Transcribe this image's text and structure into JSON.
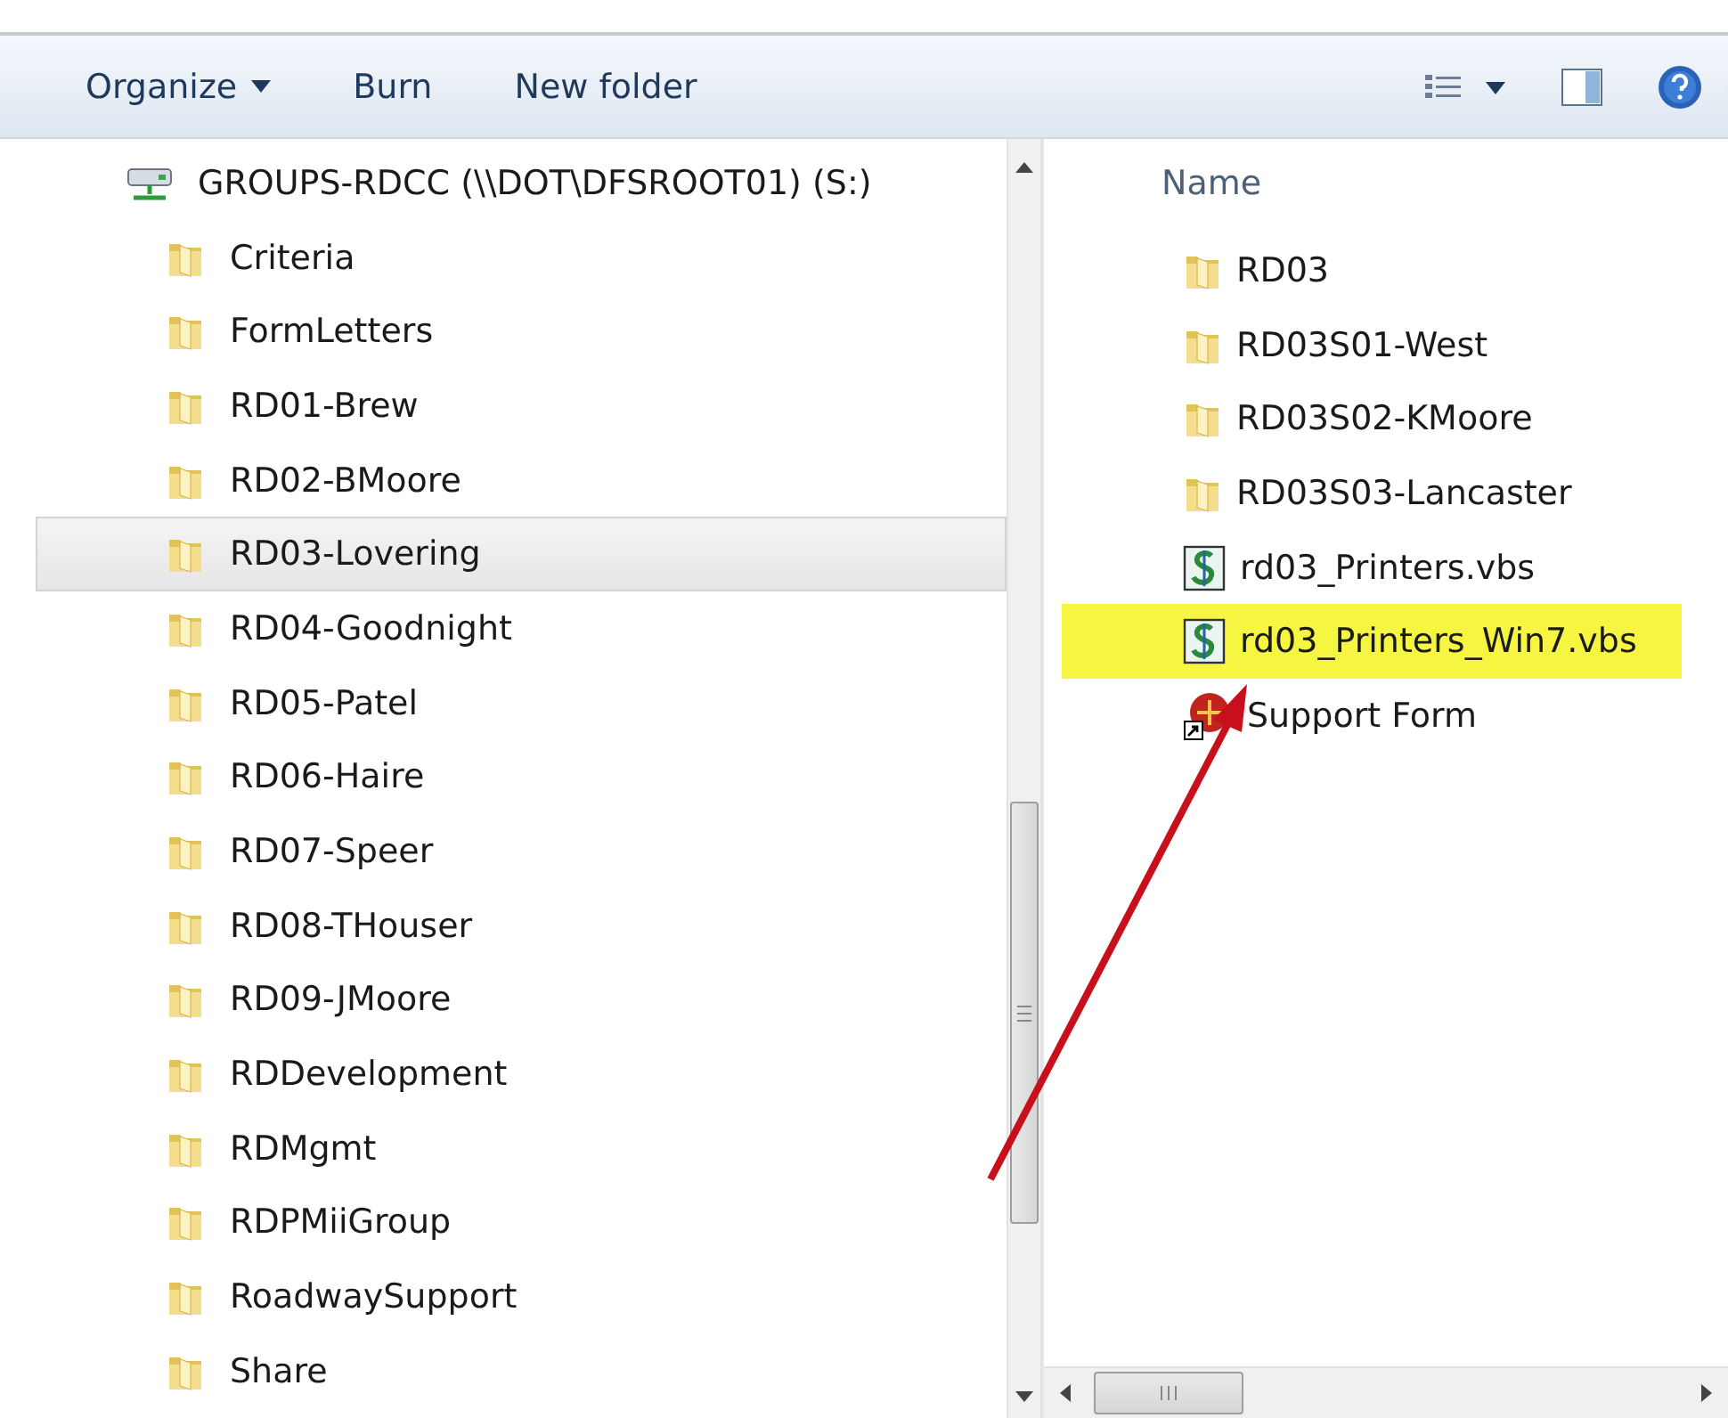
{
  "toolbar": {
    "buttons": [
      {
        "label": "Organize",
        "kind": "menu"
      },
      {
        "label": "Burn",
        "kind": "plain"
      },
      {
        "label": "New folder",
        "kind": "plain"
      }
    ]
  },
  "tree": {
    "label": "GROUPS-RDCC (\\\\DOT\\DFSROOT01) (S:)",
    "children": [
      {
        "label": "Criteria",
        "selected": false
      },
      {
        "label": "FormLetters",
        "selected": false
      },
      {
        "label": "RD01-Brew",
        "selected": false
      },
      {
        "label": "RD02-BMoore",
        "selected": false
      },
      {
        "label": "RD03-Lovering",
        "selected": true
      },
      {
        "label": "RD04-Goodnight",
        "selected": false
      },
      {
        "label": "RD05-Patel",
        "selected": false
      },
      {
        "label": "RD06-Haire",
        "selected": false
      },
      {
        "label": "RD07-Speer",
        "selected": false
      },
      {
        "label": "RD08-THouser",
        "selected": false
      },
      {
        "label": "RD09-JMoore",
        "selected": false
      },
      {
        "label": "RDDevelopment",
        "selected": false
      },
      {
        "label": "RDMgmt",
        "selected": false
      },
      {
        "label": "RDPMiiGroup",
        "selected": false
      },
      {
        "label": "RoadwaySupport",
        "selected": false
      },
      {
        "label": "Share",
        "selected": false
      }
    ]
  },
  "files": {
    "column": "Name",
    "items": [
      {
        "name": "RD03",
        "kind": "folder",
        "highlighted": false
      },
      {
        "name": "RD03S01-West",
        "kind": "folder",
        "highlighted": false
      },
      {
        "name": "RD03S02-KMoore",
        "kind": "folder",
        "highlighted": false
      },
      {
        "name": "RD03S03-Lancaster",
        "kind": "folder",
        "highlighted": false
      },
      {
        "name": "rd03_Printers.vbs",
        "kind": "script",
        "highlighted": false
      },
      {
        "name": "rd03_Printers_Win7.vbs",
        "kind": "script",
        "highlighted": true
      },
      {
        "name": "Support Form",
        "kind": "shortcut",
        "highlighted": false
      }
    ]
  }
}
